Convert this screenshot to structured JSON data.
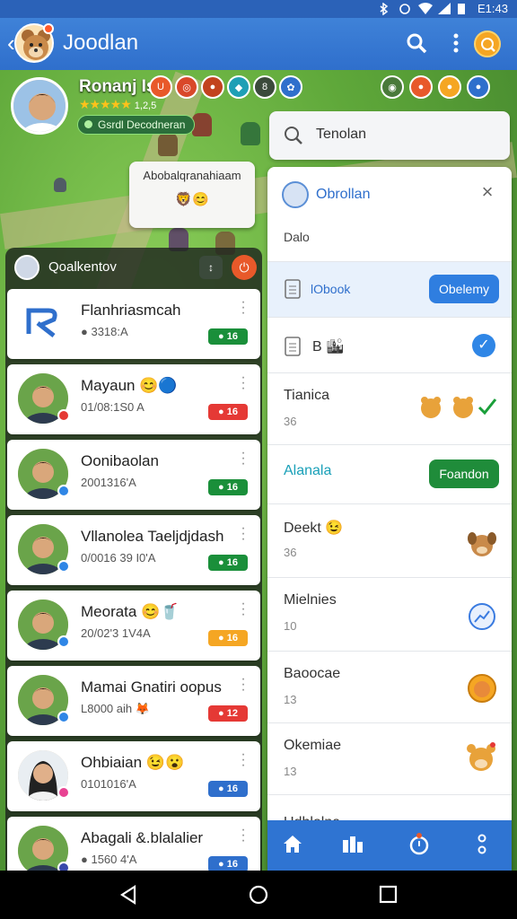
{
  "status_bar": {
    "time": "E1:43"
  },
  "app": {
    "title": "Joodlan"
  },
  "profile": {
    "name": "Ronanj Is",
    "rating_count": "1,2,5",
    "subtitle": "Gsrdl Decodneran"
  },
  "map_bubble": {
    "text": "Abobalqranahiaam",
    "emoji": "🦁😊"
  },
  "left_panel": {
    "title": "Qoalkentov",
    "contacts": [
      {
        "name": "Flanhriasmcah",
        "sub": "● 3318:A",
        "tag": "● 16",
        "tag_color": "#1a8f3a",
        "dot": "",
        "avatar": "logo"
      },
      {
        "name": "Mayaun 😊🔵",
        "sub": "01/08:1S0 A",
        "tag": "● 16",
        "tag_color": "#e53935",
        "dot": "#e53935",
        "avatar": "man"
      },
      {
        "name": "Oonibaolan",
        "sub": "2001316'A",
        "tag": "● 16",
        "tag_color": "#1a8f3a",
        "dot": "#2f86e6",
        "avatar": "man"
      },
      {
        "name": "Vllanolea Taeljdjdash",
        "sub": "0/0016 39 I0'A",
        "tag": "● 16",
        "tag_color": "#1a8f3a",
        "dot": "#2f86e6",
        "avatar": "man"
      },
      {
        "name": "Meorata 😊🥤",
        "sub": "20/02'3 1V4A",
        "tag": "● 16",
        "tag_color": "#f5a623",
        "dot": "#2f86e6",
        "avatar": "man"
      },
      {
        "name": "Mamai Gnatiri oopus",
        "sub": "L8000 aih 🦊",
        "tag": "● 12",
        "tag_color": "#e53935",
        "dot": "#2f86e6",
        "avatar": "man"
      },
      {
        "name": "Ohbiaian 😉😮",
        "sub": "0101016'A",
        "tag": "● 16",
        "tag_color": "#2f6fcc",
        "dot": "#e84393",
        "avatar": "woman"
      },
      {
        "name": "Abagali &.blalalier",
        "sub": "● 1560 4'A",
        "tag": "● 16",
        "tag_color": "#2f6fcc",
        "dot": "#3949ab",
        "avatar": "man"
      }
    ]
  },
  "search": {
    "placeholder": "Tenolan"
  },
  "right_panel": {
    "title": "Obrollan",
    "subtitle": "Dalo",
    "items": [
      {
        "label": "lObook",
        "kind": "button-blue",
        "button": "Obelemy"
      },
      {
        "label": "B 🏙",
        "kind": "check"
      },
      {
        "label": "Tianica",
        "num": "36",
        "kind": "emoji-pair"
      },
      {
        "label": "Alanala",
        "kind": "button-green",
        "button": "Foandon"
      },
      {
        "label": "Deekt 😉",
        "num": "36",
        "kind": "pet"
      },
      {
        "label": "Mielnies",
        "num": "10",
        "kind": "ring"
      },
      {
        "label": "Baoocae",
        "num": "13",
        "kind": "coinpet"
      },
      {
        "label": "Okemiae",
        "num": "13",
        "kind": "bear"
      },
      {
        "label": "Udhlolna",
        "kind": "partial"
      }
    ]
  },
  "bottom_nav": [
    "home-icon",
    "buildings-icon",
    "alarm-icon",
    "more-vertical-icon"
  ]
}
